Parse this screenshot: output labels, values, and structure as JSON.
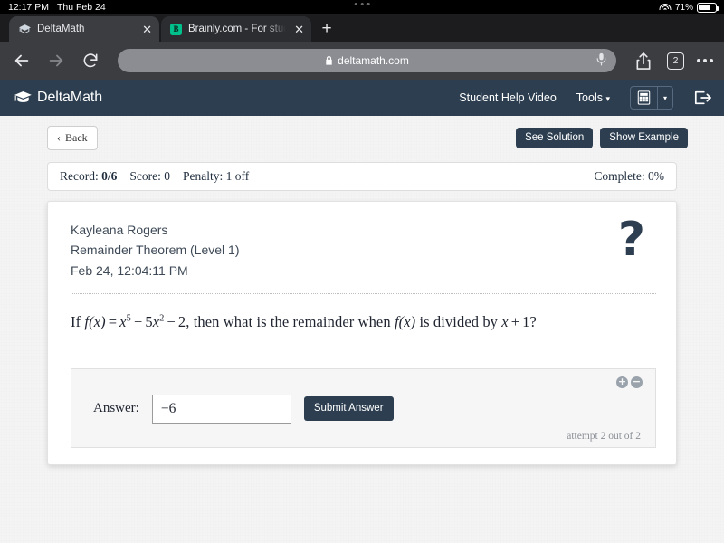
{
  "status_bar": {
    "time": "12:17 PM",
    "date": "Thu Feb 24",
    "wifi_icon": "wifi-icon",
    "battery_percent": "71%",
    "battery_icon": "battery-icon",
    "multitask_icon": "multitask-dots-icon"
  },
  "browser": {
    "tabs": [
      {
        "title": "DeltaMath",
        "favicon": "deltamath-graduation-cap-icon",
        "close_label": "✕",
        "active": true
      },
      {
        "title": "Brainly.com - For students.",
        "favicon": "brainly-b-icon",
        "close_label": "✕",
        "active": false
      }
    ],
    "new_tab_label": "+",
    "back_icon": "back-arrow-icon",
    "forward_icon": "forward-arrow-icon",
    "reload_icon": "reload-icon",
    "lock_icon": "lock-icon",
    "url": "deltamath.com",
    "mic_icon": "microphone-icon",
    "share_icon": "share-icon",
    "tab_count": "2",
    "more_icon": "more-dots-icon"
  },
  "dm_nav": {
    "brand": "DeltaMath",
    "brand_icon": "graduation-cap-icon",
    "help_video": "Student Help Video",
    "tools": "Tools",
    "tools_caret": "▾",
    "calculator_icon": "calculator-icon",
    "calculator_caret": "▾",
    "logout_icon": "logout-icon"
  },
  "toolbar": {
    "back_label": "Back",
    "back_chevron": "‹",
    "see_solution": "See Solution",
    "show_example": "Show Example"
  },
  "record_bar": {
    "record_label": "Record:",
    "record_value": "0/6",
    "score_label": "Score:",
    "score_value": "0",
    "penalty_label": "Penalty:",
    "penalty_value": "1 off",
    "complete_label": "Complete:",
    "complete_value": "0%"
  },
  "problem": {
    "student_name": "Kayleana Rogers",
    "assignment": "Remainder Theorem (Level 1)",
    "timestamp": "Feb 24, 12:04:11 PM",
    "help_icon": "question-mark-icon",
    "question_parts": {
      "p1": "If ",
      "f1": "f",
      "fx1": "(x)",
      "eq": "=",
      "x5": "x",
      "exp5": "5",
      "minus1": "−",
      "five": "5",
      "x2": "x",
      "exp2": "2",
      "minus2": "−",
      "two": "2",
      "p2": ", then what is the remainder when ",
      "f2": "f",
      "fx2": "(x)",
      "p3": " is divided by ",
      "xvar": "x",
      "plus": "+",
      "one": "1",
      "p4": "?"
    },
    "question_plain": "If f(x) = x^5 - 5x^2 - 2, then what is the remainder when f(x) is divided by x + 1?"
  },
  "answer_area": {
    "zoom_in": "+",
    "zoom_out": "−",
    "answer_label": "Answer:",
    "answer_value": "−6",
    "answer_placeholder": "",
    "submit_label": "Submit Answer",
    "attempt_text": "attempt 2 out of 2"
  },
  "colors": {
    "navy": "#2c3e50",
    "page_bg": "#f4f4f4",
    "toolbar_gray": "#3b3d41",
    "tab_strip": "#1c1c1e",
    "brainly_green": "#00c08b"
  }
}
